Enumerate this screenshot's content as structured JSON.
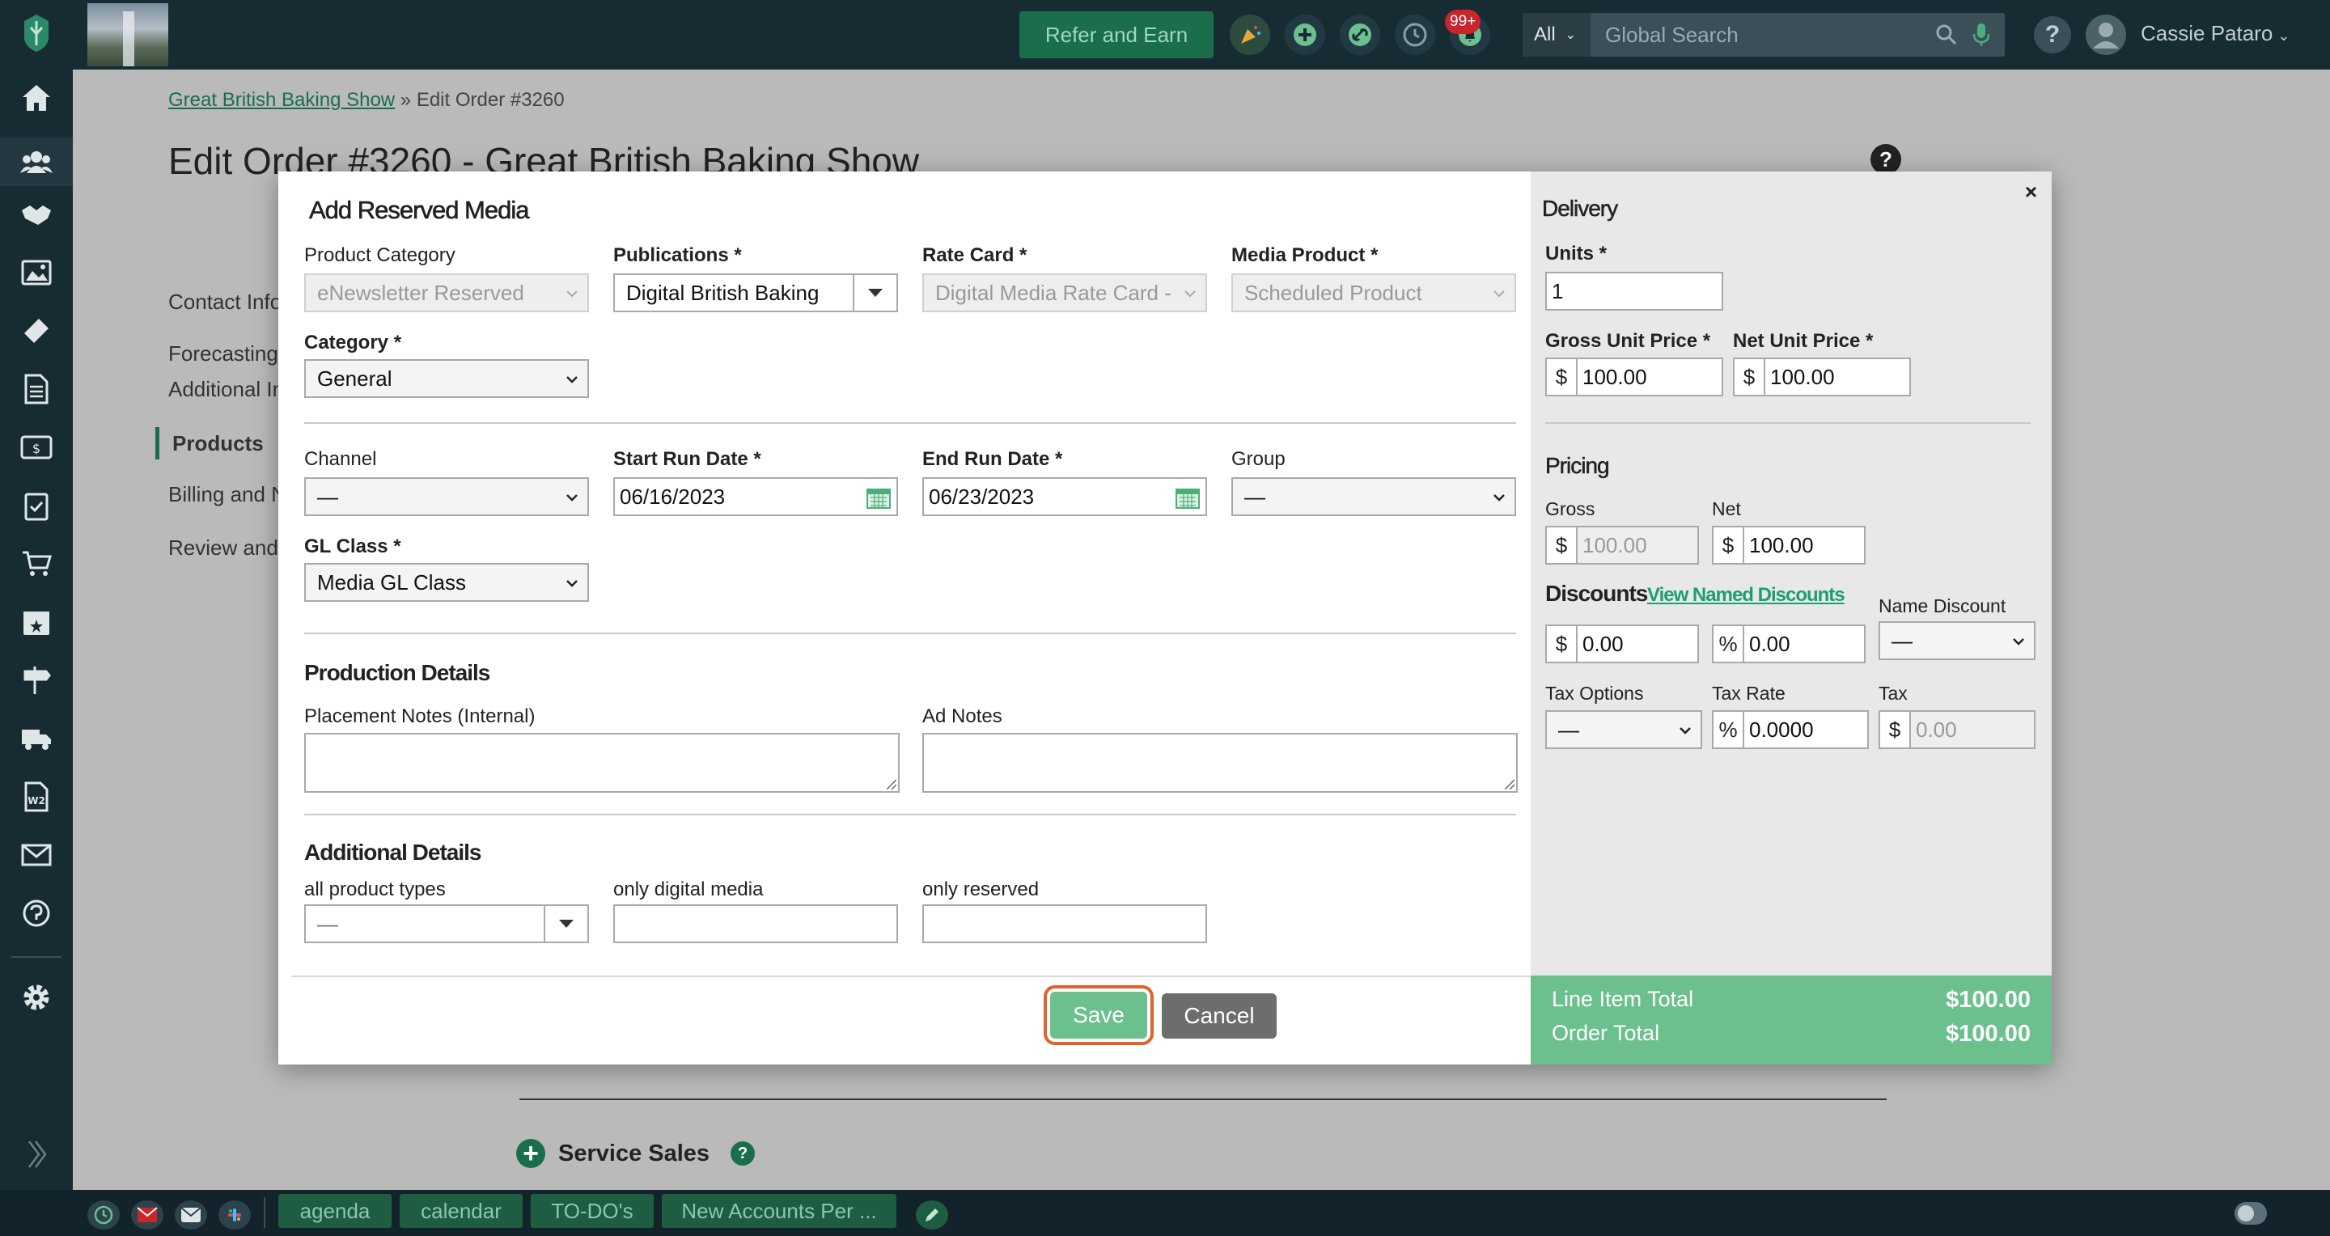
{
  "topbar": {
    "refer_label": "Refer and Earn",
    "notification_count": "99+",
    "search_scope": "All",
    "search_placeholder": "Global Search",
    "user_name": "Cassie Pataro",
    "help_label": "?"
  },
  "page": {
    "breadcrumb_link": "Great British Baking Show",
    "breadcrumb_sep": "»",
    "breadcrumb_current": "Edit Order #3260",
    "title": "Edit Order #3260 - Great British Baking Show",
    "help_label": "?",
    "steps": [
      "Contact Info",
      "Forecasting",
      "Additional In",
      "Products",
      "Billing and N",
      "Review and"
    ],
    "service_sales": "Service Sales"
  },
  "modal": {
    "title": "Add Reserved Media",
    "close": "×",
    "product_category_label": "Product Category",
    "product_category_value": "eNewsletter Reserved",
    "publications_label": "Publications *",
    "publications_value": "Digital British Baking",
    "rate_card_label": "Rate Card *",
    "rate_card_value": "Digital Media Rate Card -",
    "media_product_label": "Media Product *",
    "media_product_value": "Scheduled Product",
    "category_label": "Category *",
    "category_value": "General",
    "channel_label": "Channel",
    "channel_value": "—",
    "start_run_label": "Start Run Date *",
    "start_run_value": "06/16/2023",
    "end_run_label": "End Run Date *",
    "end_run_value": "06/23/2023",
    "group_label": "Group",
    "group_value": "—",
    "gl_class_label": "GL Class *",
    "gl_class_value": "Media GL Class",
    "production_heading": "Production Details",
    "placement_notes_label": "Placement Notes (Internal)",
    "ad_notes_label": "Ad Notes",
    "additional_heading": "Additional Details",
    "all_product_types_label": "all product types",
    "all_product_types_value": "—",
    "only_digital_label": "only digital media",
    "only_reserved_label": "only reserved",
    "save_label": "Save",
    "cancel_label": "Cancel"
  },
  "delivery": {
    "heading": "Delivery",
    "units_label": "Units *",
    "units_value": "1",
    "gross_unit_label": "Gross Unit Price *",
    "gross_unit_value": "100.00",
    "net_unit_label": "Net Unit Price *",
    "net_unit_value": "100.00",
    "currency": "$",
    "percent": "%"
  },
  "pricing": {
    "heading": "Pricing",
    "gross_label": "Gross",
    "gross_value": "100.00",
    "net_label": "Net",
    "net_value": "100.00",
    "discounts_heading": "Discounts",
    "view_named_discounts": "View Named Discounts",
    "name_discount_label": "Name Discount",
    "name_discount_value": "—",
    "discount_amount": "0.00",
    "discount_percent": "0.00",
    "tax_options_label": "Tax Options",
    "tax_options_value": "—",
    "tax_rate_label": "Tax Rate",
    "tax_rate_value": "0.0000",
    "tax_label": "Tax",
    "tax_value": "0.00"
  },
  "totals": {
    "line_item_label": "Line Item Total",
    "line_item_value": "$100.00",
    "order_total_label": "Order Total",
    "order_total_value": "$100.00"
  },
  "bottombar": {
    "tabs": [
      "agenda",
      "calendar",
      "TO-DO's",
      "New Accounts Per ..."
    ]
  },
  "colors": {
    "topbar": "#172b33",
    "brand_green": "#1a6e4b",
    "save_green": "#6cc08e",
    "focus_orange": "#e0622c",
    "badge_red": "#c9252c"
  }
}
